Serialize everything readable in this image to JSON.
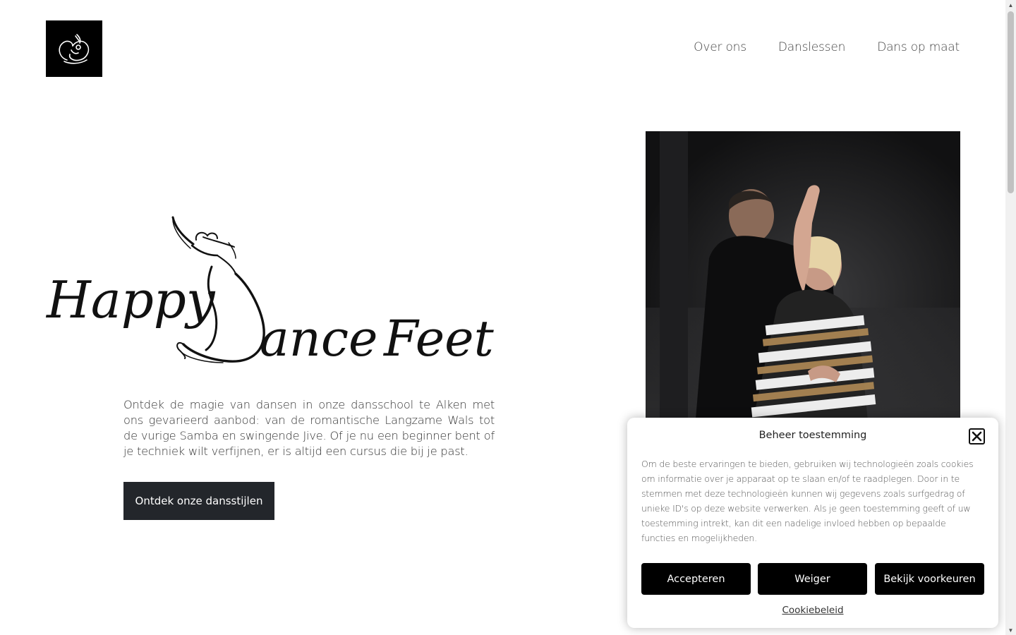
{
  "header": {
    "logo_icon": "dancer-logo-icon",
    "nav": [
      {
        "label": "Over ons"
      },
      {
        "label": "Danslessen"
      },
      {
        "label": "Dans op maat"
      }
    ]
  },
  "hero": {
    "brand_logo": {
      "word1": "Happy",
      "word2": "ance",
      "word3": "Feet",
      "icon": "dancing-couple-logo-icon",
      "text": "Happy Dance Feet"
    },
    "intro": "Ontdek de magie van dansen in onze dansschool te Alken met ons gevarieerd aanbod: van de romantische Langzame Wals tot de vurige Samba en swingende Jive. Of je nu een beginner bent of je techniek wilt verfijnen, er is altijd een cursus die bij je past.",
    "cta_label": "Ontdek onze dansstijlen",
    "photo": "dancing-couple-photo"
  },
  "consent": {
    "title": "Beheer toestemming",
    "close_icon": "close-icon",
    "text": "Om de beste ervaringen te bieden, gebruiken wij technologieën zoals cookies om informatie over je apparaat op te slaan en/of te raadplegen. Door in te stemmen met deze technologieën kunnen wij gegevens zoals surfgedrag of unieke ID's op deze website verwerken. Als je geen toestemming geeft of uw toestemming intrekt, kan dit een nadelige invloed hebben op bepaalde functies en mogelijkheden.",
    "accept_label": "Accepteren",
    "deny_label": "Weiger",
    "prefs_label": "Bekijk voorkeuren",
    "policy_link": "Cookiebeleid"
  },
  "colors": {
    "button_dark": "#23262b",
    "consent_button": "#000000",
    "text": "#333333"
  }
}
